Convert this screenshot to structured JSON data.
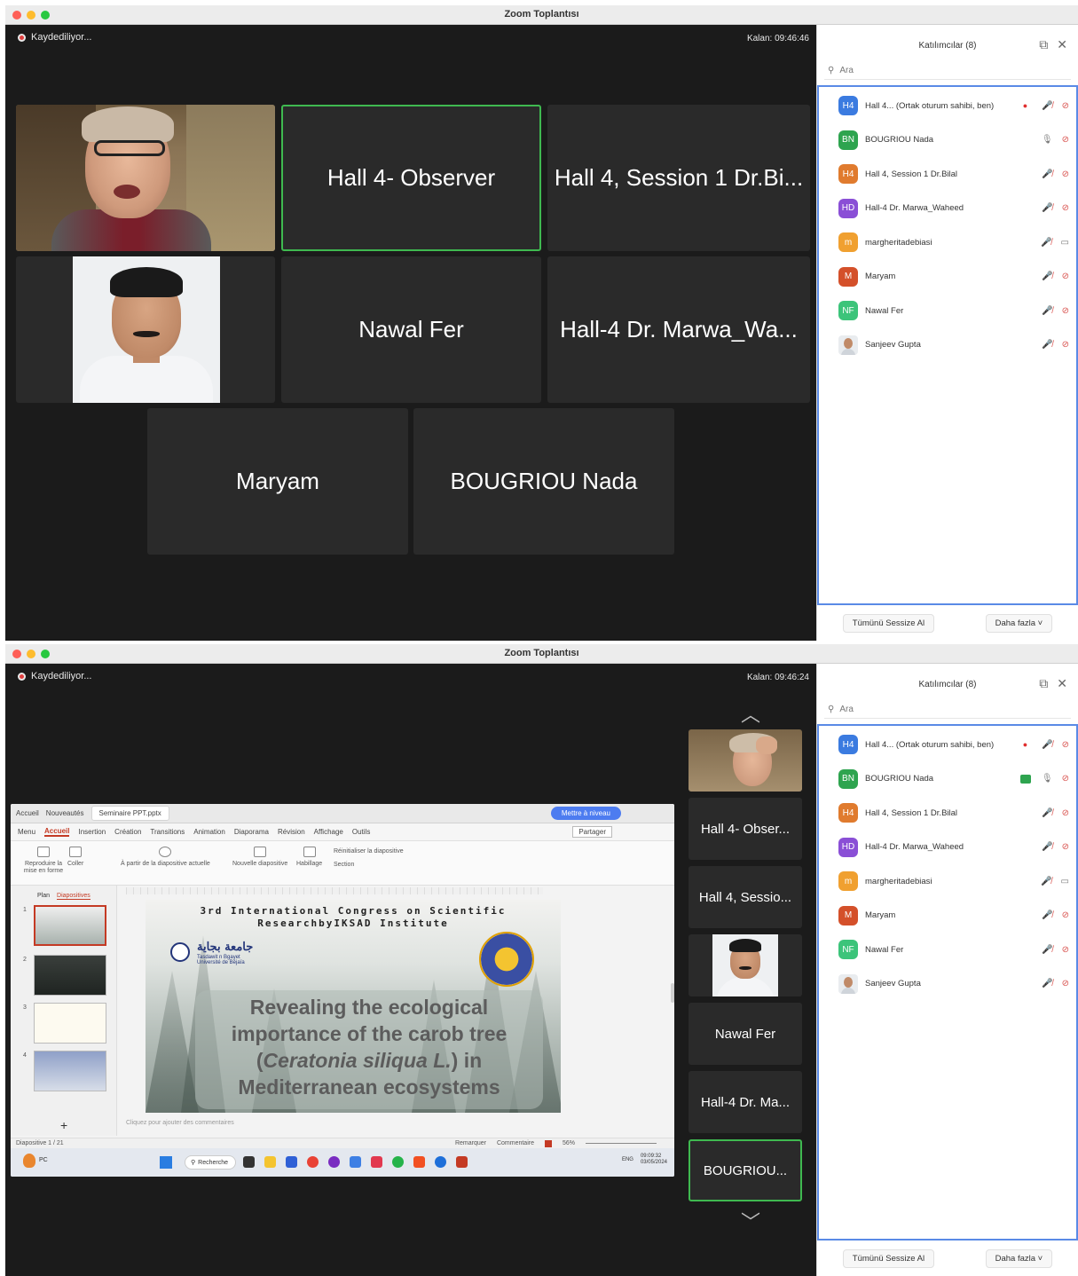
{
  "window1": {
    "title": "Zoom Toplantısı",
    "recording_label": "Kaydediliyor...",
    "timer": "Kalan: 09:46:46",
    "tiles": [
      {
        "label": ""
      },
      {
        "label": "Hall 4- Observer"
      },
      {
        "label": "Hall 4, Session 1 Dr.Bi..."
      },
      {
        "label": ""
      },
      {
        "label": "Nawal Fer"
      },
      {
        "label": "Hall-4 Dr. Marwa_Wa..."
      },
      {
        "label": "Maryam"
      },
      {
        "label": "BOUGRIOU Nada"
      }
    ]
  },
  "window2": {
    "title": "Zoom Toplantısı",
    "recording_label": "Kaydediliyor...",
    "timer": "Kalan: 09:46:24",
    "strip_tiles": [
      {
        "label": ""
      },
      {
        "label": "Hall 4- Obser..."
      },
      {
        "label": "Hall 4, Sessio..."
      },
      {
        "label": ""
      },
      {
        "label": "Nawal Fer"
      },
      {
        "label": "Hall-4 Dr. Ma..."
      },
      {
        "label": "BOUGRIOU..."
      }
    ],
    "arrow_up": "︿",
    "arrow_down": "﹀"
  },
  "sidebar": {
    "title": "Katılımcılar (8)",
    "popout_icon": "popout-icon",
    "close_icon": "close-icon",
    "search_placeholder": "Ara",
    "participants": [
      {
        "initials": "H4",
        "color": "#3b7be0",
        "name": "Hall 4... (Ortak oturum sahibi, ben)",
        "host": true
      },
      {
        "initials": "BN",
        "color": "#2ea44f",
        "name": "BOUGRIOU Nada",
        "host": false
      },
      {
        "initials": "H4",
        "color": "#e07b2e",
        "name": "Hall 4, Session 1 Dr.Bilal",
        "host": false
      },
      {
        "initials": "HD",
        "color": "#8a4fd6",
        "name": "Hall-4 Dr. Marwa_Waheed",
        "host": false
      },
      {
        "initials": "m",
        "color": "#f0a030",
        "name": "margheritadebiasi",
        "host": false
      },
      {
        "initials": "M",
        "color": "#d4502a",
        "name": "Maryam",
        "host": false
      },
      {
        "initials": "NF",
        "color": "#3cc47a",
        "name": "Nawal Fer",
        "host": false
      },
      {
        "initials": "",
        "color": "photo",
        "name": "Sanjeev Gupta",
        "host": false
      }
    ],
    "mute_all": "Tümünü Sessize Al",
    "more": "Daha fazla"
  },
  "shared_screen": {
    "app_tab_home": "Accueil",
    "app_tab_new": "Nouveautés",
    "file_tab": "Seminaire PPT.pptx",
    "share_button": "Mettre à niveau",
    "menu": [
      "Menu",
      "Accueil",
      "Insertion",
      "Création",
      "Transitions",
      "Animation",
      "Diaporama",
      "Révision",
      "Affichage",
      "Outils"
    ],
    "partager": "Partager",
    "ribbon": [
      "Reproduire la mise en forme",
      "Coller",
      "À partir de la diapositive actuelle",
      "Nouvelle diapositive",
      "Habillage",
      "Réinitialiser la diapositive",
      "Section"
    ],
    "thumbs_plan": "Plan",
    "thumbs_slides": "Diapositives",
    "slide_heading_1": "3rd International Congress on Scientific",
    "slide_heading_2": "ResearchbyIKSAD Institute",
    "uni_arabic": "جامعة بجاية",
    "uni_latin": "Tasdawit n Bgayet Université de Béjaïa",
    "slide_title_1": "Revealing the ecological",
    "slide_title_2": "importance of the carob tree",
    "slide_title_3a": "(",
    "slide_title_3b": "Ceratonia siliqua L.",
    "slide_title_3c": ") in",
    "slide_title_4": "Mediterranean ecosystems",
    "notes_hint": "Cliquez pour ajouter des commentaires",
    "status_slide": "Diapositive 1 / 21",
    "status_remarks": "Remarquer",
    "status_comment": "Commentaire",
    "status_zoom": "56%",
    "taskbar_search": "Recherche",
    "taskbar_lang": "ENG",
    "taskbar_time": "09:09:32",
    "taskbar_date": "03/05/2024",
    "taskbar_user": "PC"
  }
}
